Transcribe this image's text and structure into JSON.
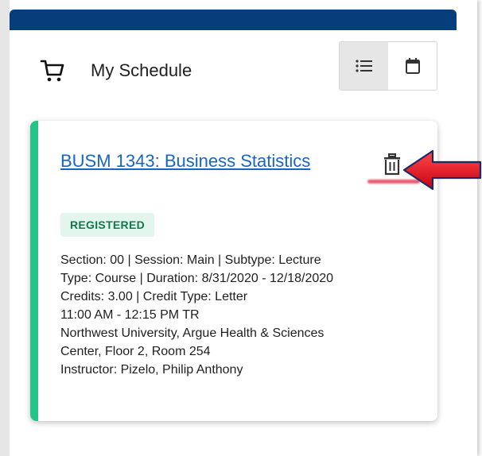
{
  "header": {
    "title": "My Schedule",
    "icons": {
      "cart": "cart-icon",
      "list_view": "list-view-icon",
      "calendar_view": "calendar-view-icon"
    }
  },
  "course": {
    "title": "BUSM 1343: Business Statistics",
    "status": "REGISTERED",
    "details": [
      "Section: 00 | Session: Main | Subtype: Lecture",
      "Type: Course | Duration: 8/31/2020 - 12/18/2020",
      "Credits: 3.00 | Credit Type: Letter",
      "11:00 AM - 12:15 PM TR",
      "Northwest University, Argue Health & Sciences",
      "Center, Floor 2, Room 254",
      "Instructor: Pizelo, Philip Anthony"
    ],
    "delete_icon": "trash-icon"
  },
  "colors": {
    "topbar": "#063e7c",
    "card_accent": "#26c489",
    "link": "#1766c4",
    "badge_bg": "#e3f6ee",
    "badge_text": "#0f7a49",
    "annotation_arrow": "#e01020"
  }
}
